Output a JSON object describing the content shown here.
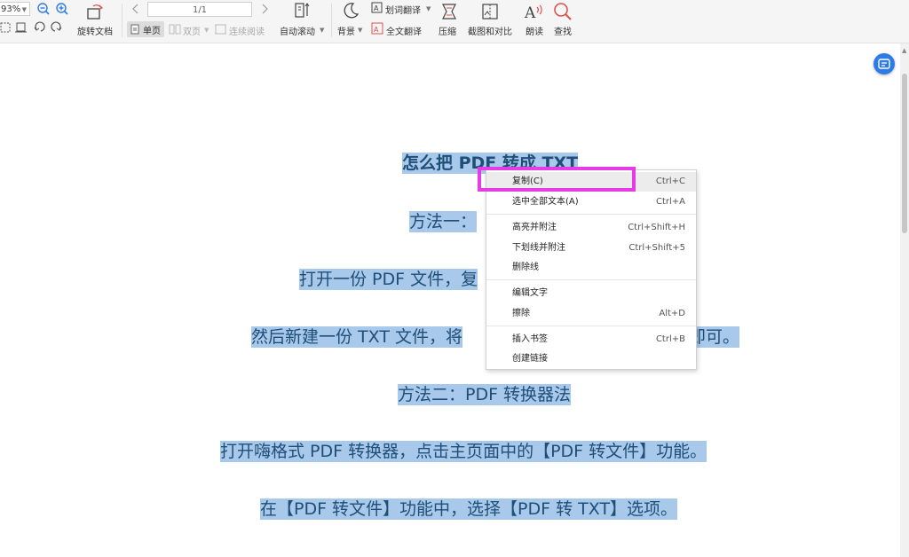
{
  "toolbar": {
    "zoom_value": "93%",
    "page_value": "1/1",
    "rotate_label": "旋转文档",
    "single_page_label": "单页",
    "double_page_label": "双页",
    "continuous_label": "连续阅读",
    "auto_scroll_label": "自动滚动",
    "background_label": "背景",
    "word_translate_label": "划词翻译",
    "full_translate_label": "全文翻译",
    "compress_label": "压缩",
    "screenshot_compare_label": "截图和对比",
    "read_aloud_label": "朗读",
    "find_label": "查找"
  },
  "document": {
    "title_line": "怎么把 PDF 转成 TXT",
    "method1_line": "方法一：",
    "step1_line": "打开一份 PDF 文件，复",
    "step2_left": "然后新建一份 TXT 文件，将",
    "step2_right": "即可。",
    "method2_line": "方法二：PDF 转换器法",
    "step3_line": "打开嗨格式 PDF 转换器，点击主页面中的【PDF 转文件】功能。",
    "step4_line": "在【PDF 转文件】功能中，选择【PDF 转 TXT】选项。"
  },
  "context_menu": {
    "items": [
      {
        "label": "复制(C)",
        "shortcut": "Ctrl+C"
      },
      {
        "label": "选中全部文本(A)",
        "shortcut": "Ctrl+A"
      },
      {
        "label": "高亮并附注",
        "shortcut": "Ctrl+Shift+H"
      },
      {
        "label": "下划线并附注",
        "shortcut": "Ctrl+Shift+5"
      },
      {
        "label": "删除线",
        "shortcut": ""
      },
      {
        "label": "编辑文字",
        "shortcut": ""
      },
      {
        "label": "擦除",
        "shortcut": "Alt+D"
      },
      {
        "label": "插入书签",
        "shortcut": "Ctrl+B"
      },
      {
        "label": "创建链接",
        "shortcut": ""
      }
    ]
  },
  "colors": {
    "text": "#1f4e79",
    "selection": "#a8c9ea",
    "highlight_outline": "#e63ce6",
    "accent": "#2f7be5"
  },
  "icons": [
    "zoom-out-icon",
    "zoom-in-icon",
    "rotate-document-icon",
    "page-prev-icon",
    "page-next-icon",
    "auto-scroll-icon",
    "background-icon",
    "word-translate-icon",
    "full-translate-icon",
    "compress-icon",
    "screenshot-compare-icon",
    "read-aloud-icon",
    "find-icon",
    "ai-assistant-icon"
  ]
}
